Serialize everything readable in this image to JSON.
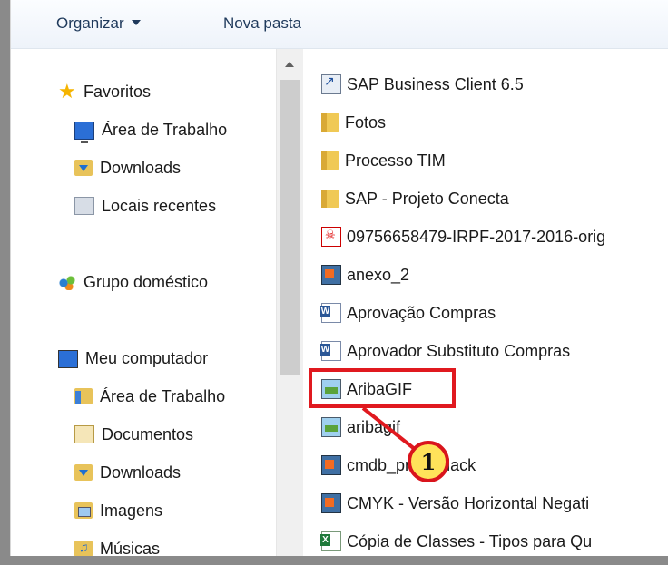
{
  "toolbar": {
    "organize_label": "Organizar",
    "new_folder_label": "Nova pasta"
  },
  "nav": {
    "favorites_label": "Favoritos",
    "favorites_items": [
      {
        "label": "Área de Trabalho",
        "icon": "desktop-icon"
      },
      {
        "label": "Downloads",
        "icon": "downloads-icon"
      },
      {
        "label": "Locais recentes",
        "icon": "recent-places-icon"
      }
    ],
    "homegroup_label": "Grupo doméstico",
    "computer_label": "Meu computador",
    "computer_items": [
      {
        "label": "Área de Trabalho",
        "icon": "desktop-folder-icon"
      },
      {
        "label": "Documentos",
        "icon": "documents-icon"
      },
      {
        "label": "Downloads",
        "icon": "downloads-icon"
      },
      {
        "label": "Imagens",
        "icon": "pictures-icon"
      },
      {
        "label": "Músicas",
        "icon": "music-icon"
      }
    ]
  },
  "files": [
    {
      "name": "SAP Business Client 6.5",
      "icon": "shortcut-icon"
    },
    {
      "name": "Fotos",
      "icon": "folder-icon"
    },
    {
      "name": "Processo TIM",
      "icon": "folder-icon"
    },
    {
      "name": "SAP - Projeto Conecta",
      "icon": "folder-icon"
    },
    {
      "name": "09756658479-IRPF-2017-2016-orig",
      "icon": "pdf-icon"
    },
    {
      "name": "anexo_2",
      "icon": "image-file-icon"
    },
    {
      "name": "Aprovação Compras",
      "icon": "word-document-icon"
    },
    {
      "name": "Aprovador Substituto Compras",
      "icon": "word-document-icon"
    },
    {
      "name": "AribaGIF",
      "icon": "gif-image-icon"
    },
    {
      "name": "aribagif",
      "icon": "image-file-icon"
    },
    {
      "name": "cmdb_prod_black",
      "icon": "image-file-icon"
    },
    {
      "name": "CMYK - Versão Horizontal Negati",
      "icon": "image-file-icon"
    },
    {
      "name": "Cópia de Classes - Tipos para Qu",
      "icon": "excel-document-icon"
    }
  ],
  "callout": {
    "number": "1",
    "color": "#e0191f",
    "badge_fill": "#ffe25a"
  }
}
